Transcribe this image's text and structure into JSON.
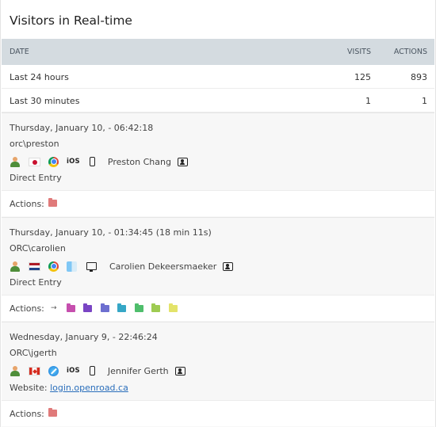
{
  "widget": {
    "title": "Visitors in Real-time"
  },
  "table": {
    "headers": {
      "date": "DATE",
      "visits": "VISITS",
      "actions": "ACTIONS"
    },
    "rows": [
      {
        "label": "Last 24 hours",
        "visits": "125",
        "actions": "893"
      },
      {
        "label": "Last 30 minutes",
        "visits": "1",
        "actions": "1"
      }
    ]
  },
  "visits": [
    {
      "datetime": "Thursday, January 10, - 06:42:18",
      "user": "orc\\preston",
      "country_icon": "flag-japan-icon",
      "browser_icon": "chrome-icon",
      "os": "iOS",
      "device_icon": "smartphone-icon",
      "visitor_name": "Preston Chang",
      "referrer": "Direct Entry",
      "actions_label": "Actions:",
      "actions": [
        {
          "icon": "folder-icon",
          "color": "#e07a7a"
        }
      ]
    },
    {
      "datetime": "Thursday, January 10, - 01:34:45 (18 min 11s)",
      "user": "ORC\\carolien",
      "country_icon": "flag-netherlands-icon",
      "browser_icon": "chrome-icon",
      "os_icon": "finder-icon",
      "device_icon": "desktop-icon",
      "visitor_name": "Carolien Dekeersmaeker",
      "referrer": "Direct Entry",
      "actions_label": "Actions:",
      "actions": [
        {
          "icon": "arrow-icon",
          "color": "#555555"
        },
        {
          "icon": "folder-icon",
          "color": "#c64fae"
        },
        {
          "icon": "folder-icon",
          "color": "#7a45c4"
        },
        {
          "icon": "folder-icon",
          "color": "#6d6fd0"
        },
        {
          "icon": "folder-icon",
          "color": "#36a7c6"
        },
        {
          "icon": "folder-icon",
          "color": "#4fbe6c"
        },
        {
          "icon": "folder-icon",
          "color": "#9ecb52"
        },
        {
          "icon": "folder-icon",
          "color": "#e3e36a"
        }
      ]
    },
    {
      "datetime": "Wednesday, January 9, - 22:46:24",
      "user": "ORC\\jgerth",
      "country_icon": "flag-canada-icon",
      "browser_icon": "safari-icon",
      "os": "iOS",
      "device_icon": "smartphone-icon",
      "visitor_name": "Jennifer Gerth",
      "referrer_label": "Website:",
      "referrer_link": "login.openroad.ca",
      "actions_label": "Actions:",
      "actions": [
        {
          "icon": "folder-icon",
          "color": "#e07a7a"
        }
      ]
    }
  ]
}
